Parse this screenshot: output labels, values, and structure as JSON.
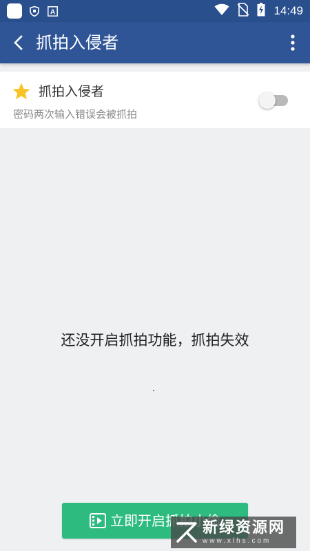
{
  "status_bar": {
    "time": "14:49",
    "small_icon_letter": "A",
    "icons": [
      "app-square-icon",
      "shield-icon",
      "a-badge-icon",
      "wifi-icon",
      "no-sim-icon",
      "battery-charging-icon"
    ]
  },
  "app_bar": {
    "title": "抓拍入侵者",
    "back_icon": "chevron-left-icon",
    "more_icon": "more-vertical-icon"
  },
  "setting": {
    "title": "抓拍入侵者",
    "description": "密码两次输入错误会被抓拍",
    "icon": "star-icon",
    "enabled": false
  },
  "empty_state": {
    "message": "还没开启抓拍功能，抓拍失效"
  },
  "action_button": {
    "label": "立即开启抓拍小偷",
    "icon": "film-icon"
  },
  "watermark": {
    "title": "新绿资源网",
    "url": "www.xlhs.com"
  },
  "colors": {
    "status_bar": "#2a4f8d",
    "app_bar": "#2f5597",
    "background": "#eef0f2",
    "accent_green": "#2dbb80",
    "star": "#f7c325"
  }
}
